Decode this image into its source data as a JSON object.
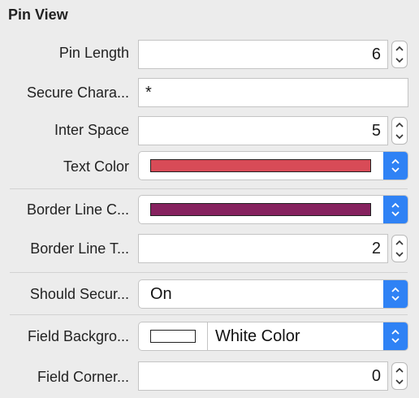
{
  "section": {
    "title": "Pin View"
  },
  "rows": {
    "pin_length": {
      "label": "Pin Length",
      "value": "6"
    },
    "secure_character": {
      "label": "Secure Chara...",
      "value": "*"
    },
    "inter_space": {
      "label": "Inter Space",
      "value": "5"
    },
    "text_color": {
      "label": "Text Color",
      "color": "#d84b57"
    },
    "border_line_color": {
      "label": "Border Line C...",
      "color": "#86225f"
    },
    "border_line_thickness": {
      "label": "Border Line T...",
      "value": "2"
    },
    "should_secure": {
      "label": "Should Secur...",
      "value": "On"
    },
    "field_background": {
      "label": "Field Backgro...",
      "value": "White Color",
      "color": "#ffffff"
    },
    "field_corner": {
      "label": "Field Corner...",
      "value": "0"
    }
  },
  "accent": "#2f82f5"
}
